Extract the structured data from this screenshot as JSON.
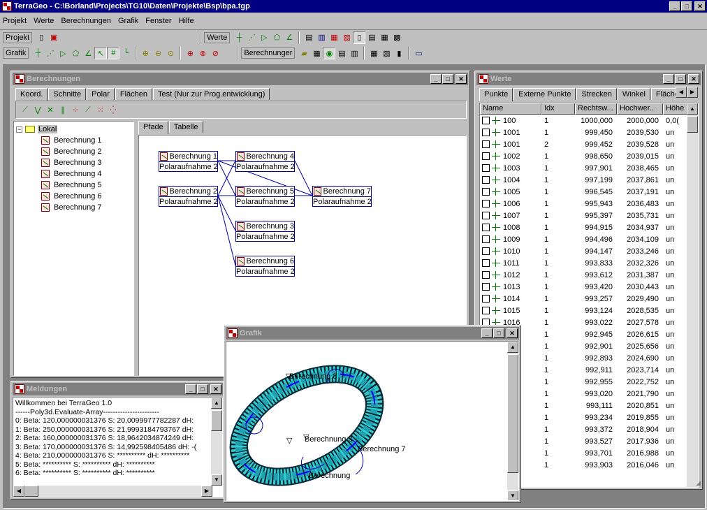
{
  "app": {
    "title": "TerraGeo - C:\\Borland\\Projects\\TG10\\Daten\\Projekte\\Bsp\\bpa.tgp"
  },
  "menu": [
    "Projekt",
    "Werte",
    "Berechnungen",
    "Grafik",
    "Fenster",
    "Hilfe"
  ],
  "toolbars": {
    "projekt_label": "Projekt",
    "werte_label": "Werte",
    "grafik_label": "Grafik",
    "berechnungen_label": "Berechnunger"
  },
  "berechnungen_window": {
    "title": "Berechnungen",
    "tabs": [
      "Koord.",
      "Schnitte",
      "Polar",
      "Flächen",
      "Test (Nur zur Prog.entwicklung)"
    ],
    "tree_root": "Lokal",
    "tree_items": [
      "Berechnung 1",
      "Berechnung 2",
      "Berechnung 3",
      "Berechnung 4",
      "Berechnung 5",
      "Berechnung 6",
      "Berechnung 7"
    ],
    "subtabs": [
      "Pfade",
      "Tabelle"
    ],
    "nodes": [
      {
        "name": "Berechnung 1",
        "type": "Polaraufnahme 2D"
      },
      {
        "name": "Berechnung 2",
        "type": "Polaraufnahme 2D"
      },
      {
        "name": "Berechnung 4",
        "type": "Polaraufnahme 2D"
      },
      {
        "name": "Berechnung 5",
        "type": "Polaraufnahme 2D"
      },
      {
        "name": "Berechnung 3",
        "type": "Polaraufnahme 2D"
      },
      {
        "name": "Berechnung 6",
        "type": "Polaraufnahme 2D"
      },
      {
        "name": "Berechnung 7",
        "type": "Polaraufnahme 2D"
      }
    ]
  },
  "meldungen_window": {
    "title": "Meldungen",
    "lines": [
      "Willkommen bei TerraGeo 1.0",
      "------Poly3d.Evaluate-Array-----------------------",
      "0:  Beta: 120,000000031376   S: 20,0099977782287   dH:",
      "1:  Beta: 250,000000031376   S: 21,9993184793767   dH:",
      "2:  Beta: 160,000000031376   S: 18,9642034874249   dH:",
      "3:  Beta: 170,000000031376   S: 14,992598405486   dH: -(",
      "4:  Beta: 210,000000031376   S: **********   dH: **********",
      "5:  Beta: **********   S: **********   dH: **********",
      "6:  Beta: **********   S: **********   dH: **********"
    ]
  },
  "werte_window": {
    "title": "Werte",
    "tabs": [
      "Punkte",
      "Externe Punkte",
      "Strecken",
      "Winkel",
      "Flächen"
    ],
    "columns": [
      "Name",
      "Idx",
      "Rechtsw...",
      "Hochwer...",
      "Höhe"
    ],
    "rows": [
      [
        "100",
        "1",
        "1000,000",
        "2000,000",
        "0,0("
      ],
      [
        "1001",
        "1",
        "999,450",
        "2039,530",
        "un"
      ],
      [
        "1001",
        "2",
        "999,452",
        "2039,528",
        "un"
      ],
      [
        "1002",
        "1",
        "998,650",
        "2039,015",
        "un"
      ],
      [
        "1003",
        "1",
        "997,901",
        "2038,465",
        "un"
      ],
      [
        "1004",
        "1",
        "997,199",
        "2037,861",
        "un"
      ],
      [
        "1005",
        "1",
        "996,545",
        "2037,191",
        "un"
      ],
      [
        "1006",
        "1",
        "995,943",
        "2036,483",
        "un"
      ],
      [
        "1007",
        "1",
        "995,397",
        "2035,731",
        "un"
      ],
      [
        "1008",
        "1",
        "994,915",
        "2034,937",
        "un"
      ],
      [
        "1009",
        "1",
        "994,496",
        "2034,109",
        "un"
      ],
      [
        "1010",
        "1",
        "994,147",
        "2033,246",
        "un"
      ],
      [
        "1011",
        "1",
        "993,833",
        "2032,326",
        "un"
      ],
      [
        "1012",
        "1",
        "993,612",
        "2031,387",
        "un"
      ],
      [
        "1013",
        "1",
        "993,420",
        "2030,443",
        "un"
      ],
      [
        "1014",
        "1",
        "993,257",
        "2029,490",
        "un"
      ],
      [
        "1015",
        "1",
        "993,124",
        "2028,535",
        "un"
      ],
      [
        "1016",
        "1",
        "993,022",
        "2027,578",
        "un"
      ],
      [
        "",
        "1",
        "992,945",
        "2026,615",
        "un"
      ],
      [
        "",
        "1",
        "992,901",
        "2025,656",
        "un"
      ],
      [
        "",
        "1",
        "992,893",
        "2024,690",
        "un"
      ],
      [
        "",
        "1",
        "992,911",
        "2023,714",
        "un"
      ],
      [
        "",
        "1",
        "992,955",
        "2022,752",
        "un"
      ],
      [
        "",
        "1",
        "993,020",
        "2021,790",
        "un"
      ],
      [
        "",
        "1",
        "993,111",
        "2020,851",
        "un"
      ],
      [
        "",
        "1",
        "993,234",
        "2019,855",
        "un"
      ],
      [
        "",
        "1",
        "993,372",
        "2018,904",
        "un"
      ],
      [
        "",
        "1",
        "993,527",
        "2017,936",
        "un"
      ],
      [
        "",
        "1",
        "993,701",
        "2016,988",
        "un"
      ],
      [
        "",
        "1",
        "993,903",
        "2016,046",
        "un"
      ]
    ]
  },
  "grafik_window": {
    "title": "Grafik",
    "labels": [
      "Berechnung 8",
      "Berechnung 3",
      "Berechnung 7",
      "Berechnung"
    ]
  }
}
